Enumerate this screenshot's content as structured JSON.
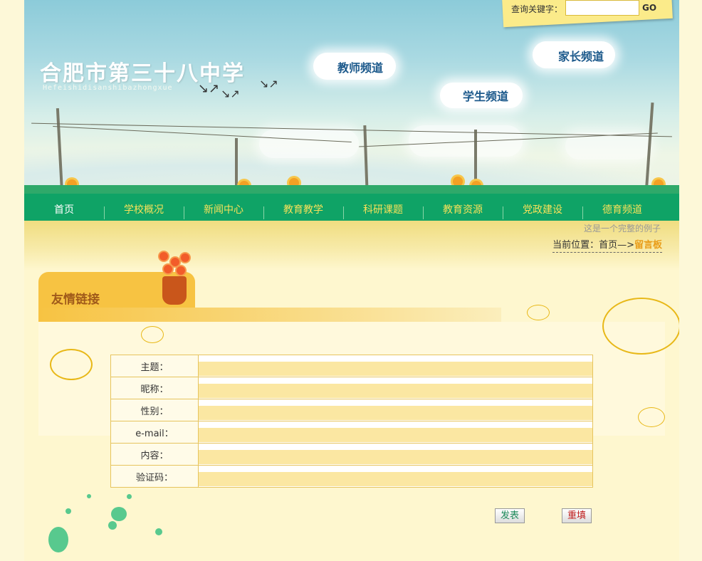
{
  "header": {
    "site_title": "合肥市第三十八中学",
    "site_subtitle": "Hefeishidisanshibazhongxue",
    "channels": {
      "teacher": "教师频道",
      "student": "学生频道",
      "parent": "家长频道"
    },
    "search": {
      "label": "查询关键字：",
      "value": "",
      "go_label": "GO"
    }
  },
  "nav": {
    "items": [
      {
        "label": "首页",
        "active": true
      },
      {
        "label": "学校概况"
      },
      {
        "label": "新闻中心"
      },
      {
        "label": "教育教学"
      },
      {
        "label": "科研课题"
      },
      {
        "label": "教育资源"
      },
      {
        "label": "党政建设"
      },
      {
        "label": "德育频道"
      }
    ]
  },
  "breadcrumb": {
    "example_note": "这是一个完整的例子",
    "prefix": "当前位置：首页—>",
    "current": "留言板"
  },
  "links_panel": {
    "title": "友情链接"
  },
  "form": {
    "fields": [
      {
        "label": "主题：",
        "value": ""
      },
      {
        "label": "昵称：",
        "value": ""
      },
      {
        "label": "性别：",
        "value": ""
      },
      {
        "label": "e-mail：",
        "value": ""
      },
      {
        "label": "内容：",
        "value": ""
      },
      {
        "label": "验证码：",
        "value": ""
      }
    ],
    "submit_label": "发表",
    "reset_label": "重填"
  },
  "colors": {
    "nav_bg": "#0fa366",
    "nav_text": "#f6e15a",
    "accent_yellow": "#f7c342",
    "field_bg": "#fbe7a2",
    "channel_text": "#1d5a8c"
  }
}
